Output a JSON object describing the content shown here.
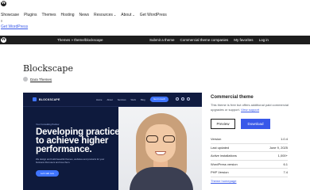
{
  "header": {
    "logo_letter": "W",
    "nav": [
      {
        "label": "Showcase",
        "caret": ""
      },
      {
        "label": "Plugins",
        "caret": ""
      },
      {
        "label": "Themes",
        "caret": ""
      },
      {
        "label": "Hosting",
        "caret": ""
      },
      {
        "label": "News",
        "caret": ""
      },
      {
        "label": "Resources",
        "caret": "⌄"
      },
      {
        "label": "About",
        "caret": "⌄"
      },
      {
        "label": "Get WordPress",
        "caret": ""
      }
    ],
    "menu_icon": "≡",
    "get_wp_link": "Get WordPress"
  },
  "themes_bar": {
    "logo_letter": "W",
    "breadcrumb": "Themes » theme/blockscape",
    "links": [
      "Submit a theme",
      "Commercial theme companies",
      "My favorites",
      "Log in"
    ]
  },
  "theme": {
    "title": "Blockscape",
    "author": "Dara Themes"
  },
  "preview": {
    "brand": "BLOCKSCAPE",
    "menu": [
      "Home",
      "About",
      "Services",
      "Work",
      "Blog",
      "Contact"
    ],
    "top_button": "Get in touch",
    "tag": "Your Consulting Partner",
    "headline": "Developing practice to achieve higher performance.",
    "sub": "We design and build beautiful themes, websites and products for your business that users and love them.",
    "cta": "Let's talk now"
  },
  "sidebar": {
    "title": "Commercial theme",
    "note": "This theme is free but offers additional paid commercial upgrades or support.",
    "note_link": "View support",
    "preview_btn": "Preview",
    "download_btn": "Download",
    "meta": [
      {
        "label": "Version",
        "value": "1.0.4"
      },
      {
        "label": "Last updated",
        "value": "June 9, 2025"
      },
      {
        "label": "Active installations",
        "value": "1,000+"
      },
      {
        "label": "WordPress version",
        "value": "6.1"
      },
      {
        "label": "PHP Version",
        "value": "7.4"
      }
    ],
    "homepage_link": "Theme homepage"
  }
}
